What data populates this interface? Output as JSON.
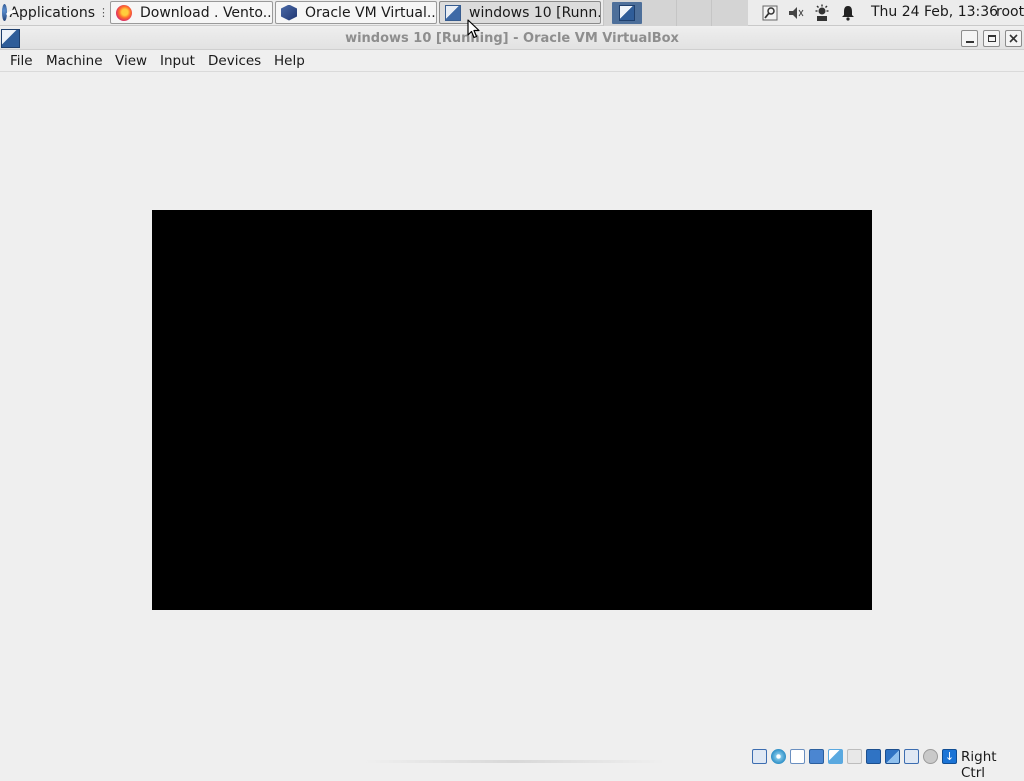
{
  "panel": {
    "applications_label": "Applications",
    "tasks": [
      {
        "label": "Download . Vento...",
        "icon": "firefox-icon"
      },
      {
        "label": "Oracle VM Virtual...",
        "icon": "virtualbox-icon"
      },
      {
        "label": "windows 10 [Runn...",
        "icon": "vm-icon"
      }
    ],
    "clock": "Thu 24 Feb, 13:36",
    "user": "root"
  },
  "window": {
    "title": "windows 10 [Running] - Oracle VM VirtualBox"
  },
  "menu": {
    "items": [
      "File",
      "Machine",
      "View",
      "Input",
      "Devices",
      "Help"
    ]
  },
  "statusbar": {
    "host_key": "Right Ctrl",
    "icons": [
      "hard-disk-icon",
      "optical-drive-icon",
      "audio-icon",
      "network-icon",
      "usb-icon",
      "shared-folders-icon",
      "display-icon",
      "video-capture-icon",
      "cpu-icon",
      "mouse-integration-icon",
      "keyboard-icon"
    ]
  },
  "colors": {
    "vm_screen": "#000000",
    "background": "#efefef"
  }
}
